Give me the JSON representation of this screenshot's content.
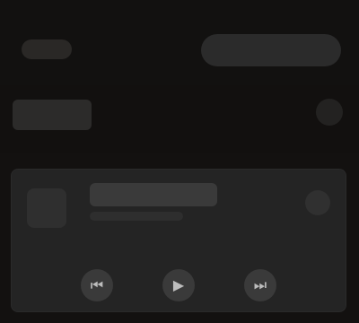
{
  "header": {
    "left_pill": "",
    "right_pill": ""
  },
  "subheader": {
    "left_chip": "",
    "right_icon": "more-icon"
  },
  "card": {
    "title": "",
    "subtitle": "",
    "left_icon": "album-art-icon",
    "right_icon": "more-icon"
  },
  "controls": {
    "prev_icon": "previous-icon",
    "play_icon": "play-icon",
    "next_icon": "next-icon"
  }
}
